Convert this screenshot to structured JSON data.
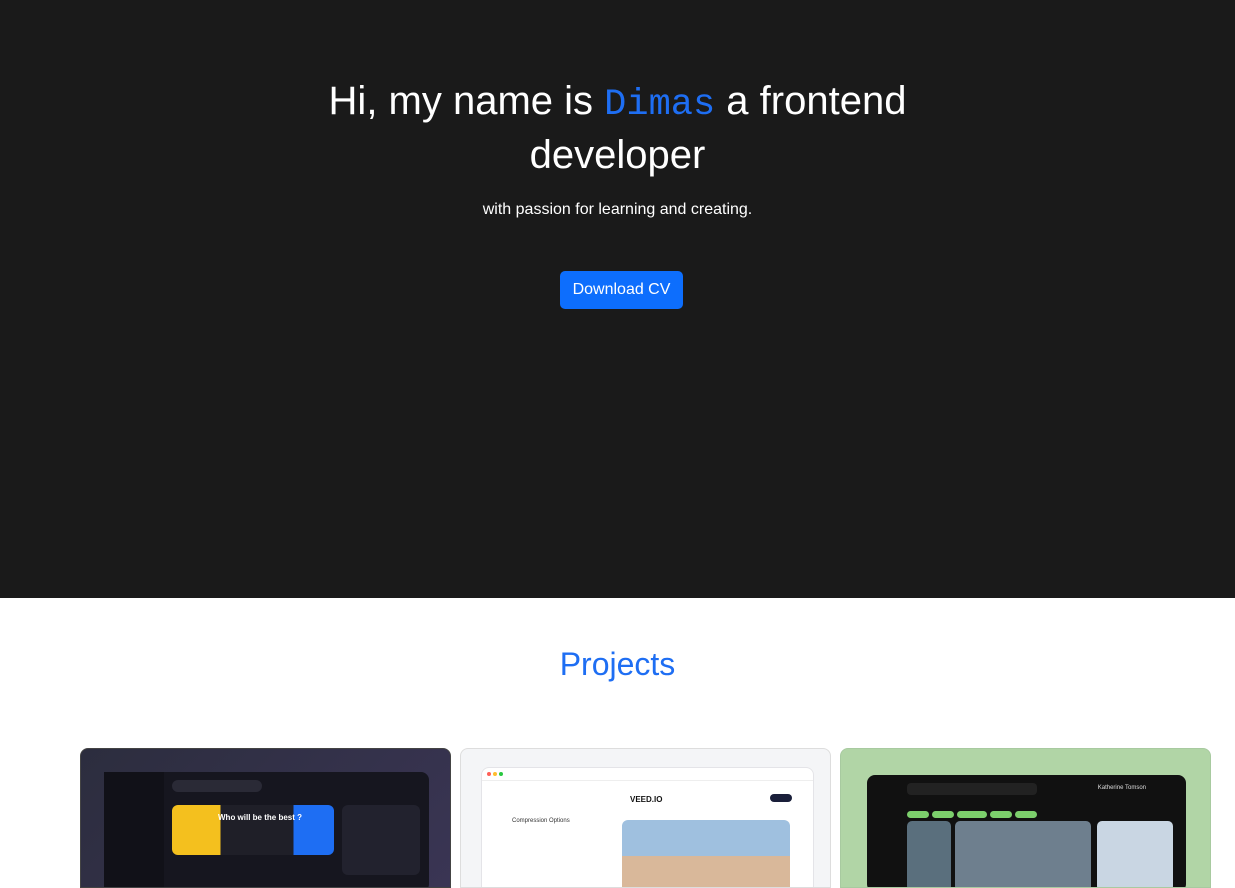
{
  "hero": {
    "title_pre": "Hi, my name is ",
    "title_name": "Dimas",
    "title_post": " a frontend developer",
    "tagline": "with passion for learning and creating.",
    "cv_button": "Download CV"
  },
  "projects": {
    "heading": "Projects",
    "cards": [
      {
        "banner_text": "Who will be the best ?"
      },
      {
        "logo": "VEED.IO",
        "label": "Compression Options"
      },
      {
        "user": "Katherine Tomson"
      }
    ]
  }
}
